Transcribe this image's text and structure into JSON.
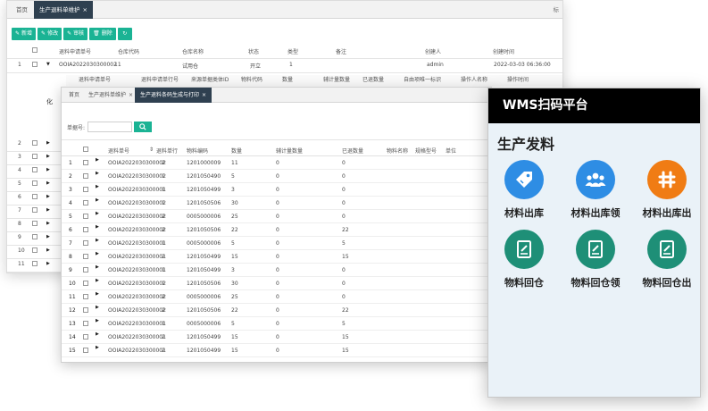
{
  "window1": {
    "tabs": [
      {
        "label": "首页",
        "active": false
      },
      {
        "label": "生产退料单维护",
        "active": true,
        "close": "×"
      }
    ],
    "more_label": "标",
    "toolbar": [
      {
        "icon": "edit-icon",
        "glyph": "✎",
        "label": "新增"
      },
      {
        "icon": "edit-icon",
        "glyph": "✎",
        "label": "修改"
      },
      {
        "icon": "edit-icon",
        "glyph": "✎",
        "label": "审核"
      },
      {
        "icon": "delete-icon",
        "glyph": "🗑",
        "label": "删除"
      },
      {
        "icon": "refresh-icon",
        "glyph": "↻",
        "label": ""
      }
    ],
    "columns": [
      "退料申请单号",
      "仓库代码",
      "仓库名称",
      "状态",
      "类型",
      "备注",
      "创建人",
      "创建时间"
    ],
    "first_row": {
      "no": "1",
      "order": "OOIA2022030300002",
      "warehouse_code": "11",
      "warehouse_name": "试用仓",
      "status": "开立",
      "type": "1",
      "creator": "admin",
      "created": "2022-03-03 06:36:00"
    },
    "row_numbers": [
      "2",
      "3",
      "4",
      "5",
      "6",
      "7",
      "8",
      "9",
      "10",
      "11"
    ],
    "sub_columns": [
      "退料申请单号",
      "退料申请单行号",
      "来源单据类体ID",
      "物料代码",
      "数量",
      "辅计量数量",
      "已退数量",
      "自由项唯一标识",
      "操作人名称",
      "操作时间"
    ],
    "side_char": "化"
  },
  "window2": {
    "tabs": [
      {
        "label": "首页",
        "active": false
      },
      {
        "label": "生产退料单维护",
        "active": false,
        "close": "×"
      },
      {
        "label": "生产退料条码生成与打印",
        "active": true,
        "close": "×"
      }
    ],
    "search_label": "单据号:",
    "columns": [
      "退料单号",
      "退料单行",
      "物料编码",
      "数量",
      "辅计量数量",
      "已退数量",
      "物料名称",
      "规格型号",
      "单位"
    ],
    "rows": [
      {
        "no": "1",
        "order": "OOIA2022030300002",
        "line": "2",
        "code": "1201000009",
        "qty": "11",
        "aux": "0",
        "done": "0"
      },
      {
        "no": "2",
        "order": "OOIA2022030300002",
        "line": "1",
        "code": "1201050490",
        "qty": "5",
        "aux": "0",
        "done": "0"
      },
      {
        "no": "3",
        "order": "OOIA2022030300001",
        "line": "1",
        "code": "1201050499",
        "qty": "3",
        "aux": "0",
        "done": "0"
      },
      {
        "no": "4",
        "order": "OOIA2022030300002",
        "line": "1",
        "code": "1201050506",
        "qty": "30",
        "aux": "0",
        "done": "0"
      },
      {
        "no": "5",
        "order": "OOIA2022030300002",
        "line": "2",
        "code": "0005000006",
        "qty": "25",
        "aux": "0",
        "done": "0"
      },
      {
        "no": "6",
        "order": "OOIA2022030300002",
        "line": "2",
        "code": "1201050506",
        "qty": "22",
        "aux": "0",
        "done": "22"
      },
      {
        "no": "7",
        "order": "OOIA2022030300001",
        "line": "1",
        "code": "0005000006",
        "qty": "5",
        "aux": "0",
        "done": "5"
      },
      {
        "no": "8",
        "order": "OOIA2022030300001",
        "line": "2",
        "code": "1201050499",
        "qty": "15",
        "aux": "0",
        "done": "15"
      },
      {
        "no": "9",
        "order": "OOIA2022030300001",
        "line": "1",
        "code": "1201050499",
        "qty": "3",
        "aux": "0",
        "done": "0"
      },
      {
        "no": "10",
        "order": "OOIA2022030300002",
        "line": "1",
        "code": "1201050506",
        "qty": "30",
        "aux": "0",
        "done": "0"
      },
      {
        "no": "11",
        "order": "OOIA2022030300002",
        "line": "2",
        "code": "0005000006",
        "qty": "25",
        "aux": "0",
        "done": "0"
      },
      {
        "no": "12",
        "order": "OOIA2022030300002",
        "line": "2",
        "code": "1201050506",
        "qty": "22",
        "aux": "0",
        "done": "22"
      },
      {
        "no": "13",
        "order": "OOIA2022030300001",
        "line": "1",
        "code": "0005000006",
        "qty": "5",
        "aux": "0",
        "done": "5"
      },
      {
        "no": "14",
        "order": "OOIA2022030300001",
        "line": "2",
        "code": "1201050499",
        "qty": "15",
        "aux": "0",
        "done": "15"
      },
      {
        "no": "15",
        "order": "OOIA2022030300001",
        "line": "2",
        "code": "1201050499",
        "qty": "15",
        "aux": "0",
        "done": "15"
      }
    ]
  },
  "phone": {
    "title": "WMS扫码平台",
    "section": "生产发料",
    "apps": [
      {
        "label": "材料出库",
        "icon": "tag-icon",
        "color": "#2e8de4"
      },
      {
        "label": "材料出库领",
        "icon": "people-icon",
        "color": "#2e8de4"
      },
      {
        "label": "材料出库出",
        "icon": "grid-icon",
        "color": "#f07c14"
      },
      {
        "label": "物料回仓",
        "icon": "document-edit-icon",
        "color": "#1e8f77"
      },
      {
        "label": "物料回仓领",
        "icon": "document-edit-icon",
        "color": "#1e8f77"
      },
      {
        "label": "物料回仓出",
        "icon": "document-edit-icon",
        "color": "#1e8f77"
      }
    ]
  }
}
